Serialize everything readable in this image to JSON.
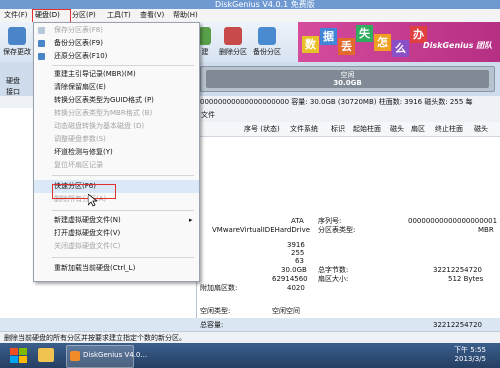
{
  "window": {
    "title": "DiskGenius V4.0.1 免费版"
  },
  "menubar": [
    {
      "label": "文件(F)"
    },
    {
      "label": "硬盘(D)"
    },
    {
      "label": "分区(P)"
    },
    {
      "label": "工具(T)"
    },
    {
      "label": "查看(V)"
    },
    {
      "label": "帮助(H)"
    }
  ],
  "toolbar": {
    "save": "保存更改",
    "create": "建",
    "delete": "删除分区",
    "backup": "备份分区"
  },
  "banner": {
    "tiles": [
      "数",
      "据",
      "丢",
      "失",
      "怎",
      "么",
      "办"
    ],
    "brand": "DiskGenius 团队"
  },
  "left_labels": {
    "disk": "硬盘",
    "iface": "接口"
  },
  "diskbar": {
    "label": "空闲",
    "size": "30.0GB"
  },
  "infoline": "00000000000000000000  容量: 30.0GB (30720MB)  柱面数: 3916  磁头数: 255  每",
  "tabs": {
    "files": "文件"
  },
  "columns": [
    "序号 (状态)",
    "文件系统",
    "标识",
    "起始柱面",
    "磁头",
    "扇区",
    "终止柱面",
    "磁头"
  ],
  "menu": {
    "items": [
      {
        "label": "保存分区表(F8)",
        "disabled": true,
        "icon": "save-icon"
      },
      {
        "label": "备份分区表(F9)",
        "disabled": false,
        "icon": "backup-icon"
      },
      {
        "label": "还原分区表(F10)",
        "disabled": false,
        "icon": "restore-icon"
      },
      {
        "label": "重建主引导记录(MBR)(M)",
        "disabled": false
      },
      {
        "label": "清除保留扇区(E)",
        "disabled": false
      },
      {
        "label": "转换分区表类型为GUID格式 (P)",
        "disabled": false
      },
      {
        "label": "转换分区表类型为MBR格式 (B)",
        "disabled": true
      },
      {
        "label": "动态磁盘转换为基本磁盘 (D)",
        "disabled": true
      },
      {
        "label": "调整硬盘参数(S)",
        "disabled": true
      },
      {
        "label": "坏道检测与修复(Y)",
        "disabled": false
      },
      {
        "label": "复位坏扇区记录",
        "disabled": true
      },
      {
        "label": "快速分区(F6)",
        "disabled": false
      },
      {
        "label": "删除所有分区(A)",
        "disabled": true
      },
      {
        "label": "新建虚拟硬盘文件(N)",
        "disabled": false,
        "arrow": "▸"
      },
      {
        "label": "打开虚拟硬盘文件(V)",
        "disabled": false
      },
      {
        "label": "关闭虚拟硬盘文件(C)",
        "disabled": true
      },
      {
        "label": "重新加载当前硬盘(Ctrl_L)",
        "disabled": false
      }
    ]
  },
  "details": {
    "iface_val": "ATA",
    "model_val": "VMwareVirtualIDEHardDrive",
    "serial_label": "序列号:",
    "serial_val": "00000000000000000001",
    "pt_label": "分区表类型:",
    "pt_val": "MBR",
    "cyl": "3916",
    "heads": "255",
    "spt": "63",
    "cap": "30.0GB",
    "total_bytes_label": "总字节数:",
    "total_bytes_val": "32212254720",
    "sectors": "62914560",
    "sector_size_label": "扇区大小:",
    "sector_size_val": "512 Bytes",
    "extra_label": "附加扇区数:",
    "extra_val": "4020",
    "free_label": "空闲类型:",
    "free_val": "空闲空间",
    "total_label": "总容量:",
    "total_val": "32212254720"
  },
  "statusbar": "删除当前硬盘的所有分区并按要求建立指定个数的新分区。",
  "taskbar": {
    "app": "DiskGenius V4.0...",
    "time": "下午 5:55",
    "date": "2013/3/5"
  }
}
